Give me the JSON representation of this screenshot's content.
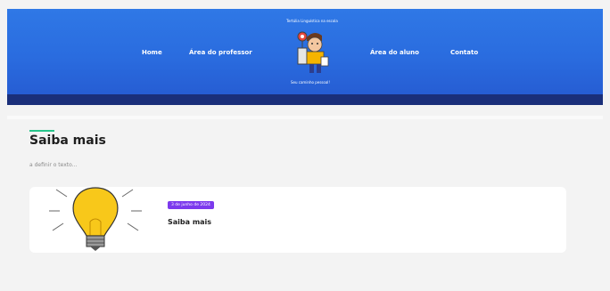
{
  "header": {
    "tagline": "Tertúlia Linguística na escola",
    "slogan": "Seu caminho pessoal!",
    "nav": [
      "Home",
      "Área do professor",
      "Área do aluno",
      "Contato"
    ]
  },
  "page": {
    "title": "Saiba mais",
    "description": "a definir o texto..."
  },
  "post": {
    "date": "3 de junho de 2024",
    "title": "Saiba mais"
  },
  "colors": {
    "header": "#2a6cdf",
    "accent": "#27c48a",
    "badge": "#7c3aed"
  }
}
